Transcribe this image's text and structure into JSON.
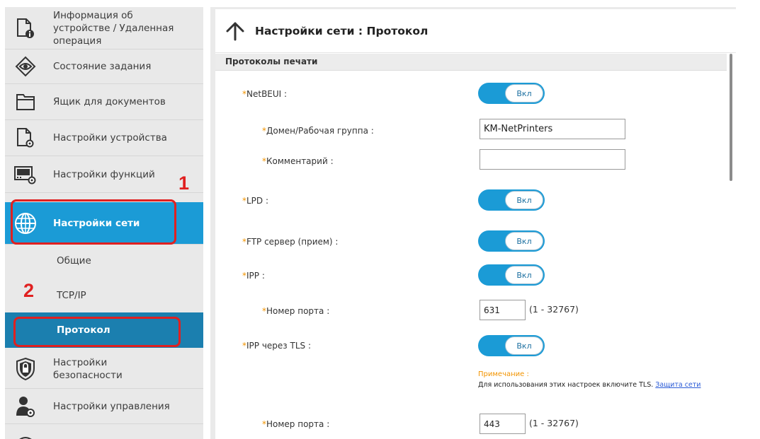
{
  "sidebar": {
    "items": [
      {
        "label": "Информация об устройстве / Удаленная операция"
      },
      {
        "label": "Состояние задания"
      },
      {
        "label": "Ящик для документов"
      },
      {
        "label": "Настройки устройства"
      },
      {
        "label": "Настройки функций"
      },
      {
        "label": "Настройки сети"
      },
      {
        "label": "Настройки безопасности"
      },
      {
        "label": "Настройки управления"
      }
    ],
    "subitems": [
      {
        "label": "Общие"
      },
      {
        "label": "TCP/IP"
      },
      {
        "label": "Протокол"
      }
    ],
    "callouts": {
      "one": "1",
      "two": "2"
    },
    "active_color": "#1b9bd6"
  },
  "header": {
    "title": "Настройки сети : Протокол"
  },
  "section": {
    "title": "Протоколы печати"
  },
  "form": {
    "required_mark": "*",
    "netbeui": {
      "label": "NetBEUI :",
      "toggle": "Вкл"
    },
    "domain": {
      "label": "Домен/Рабочая группа :",
      "value": "KM-NetPrinters"
    },
    "comment": {
      "label": "Комментарий :",
      "value": ""
    },
    "lpd": {
      "label": "LPD :",
      "toggle": "Вкл"
    },
    "ftp": {
      "label": "FTP сервер (прием) :",
      "toggle": "Вкл"
    },
    "ipp": {
      "label": "IPP :",
      "toggle": "Вкл"
    },
    "ipp_port": {
      "label": "Номер порта :",
      "value": "631",
      "range": "(1 - 32767)"
    },
    "ipp_tls": {
      "label": "IPP через TLS :",
      "toggle": "Вкл"
    },
    "note": {
      "title": "Примечание :",
      "text": "Для использования этих настроек включите TLS. ",
      "link": "Защита сети"
    },
    "ipp_tls_port": {
      "label": "Номер порта :",
      "value": "443",
      "range": "(1 - 32767)"
    }
  }
}
